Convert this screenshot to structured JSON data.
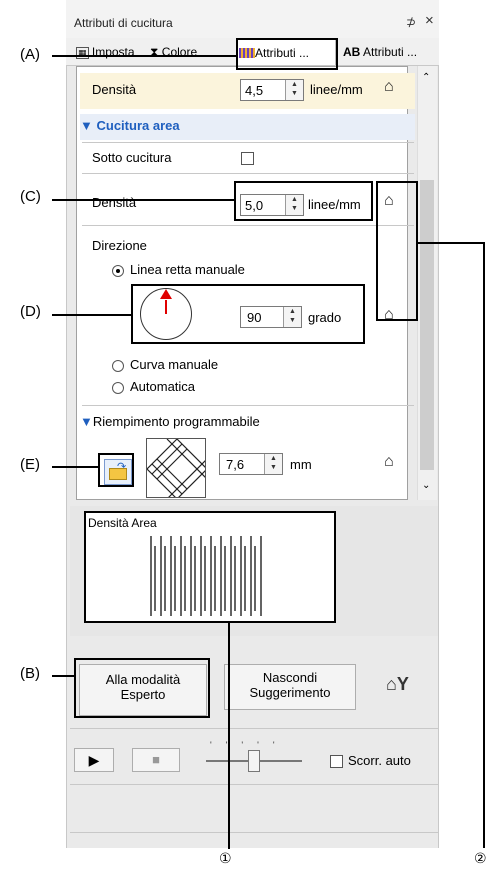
{
  "panel": {
    "title": "Attributi di cucitura",
    "pin_icon": "⊅",
    "close_icon": "×"
  },
  "tabs": [
    {
      "label": "Imposta",
      "icon": "settings-icon"
    },
    {
      "label": "Colore",
      "icon": "hourglass-icon"
    },
    {
      "label": "Attributi ...",
      "icon": "stitch-pattern-icon"
    },
    {
      "label": "Attributi ...",
      "icon": "text-ab-icon",
      "prefix": "AB"
    }
  ],
  "rows": {
    "density_top": {
      "label": "Densità",
      "value": "4,5",
      "unit": "linee/mm"
    },
    "section_area": {
      "label": "Cucitura area"
    },
    "under_sewing": {
      "label": "Sotto cucitura",
      "checked": false
    },
    "density_area": {
      "label": "Densità",
      "value": "5,0",
      "unit": "linee/mm"
    },
    "direction": {
      "label": "Direzione"
    },
    "radio_manual_line": {
      "label": "Linea retta manuale",
      "selected": true
    },
    "angle": {
      "value": "90",
      "unit": "grado"
    },
    "radio_manual_curve": {
      "label": "Curva manuale",
      "selected": false
    },
    "radio_auto": {
      "label": "Automatica",
      "selected": false
    },
    "section_prog_fill": {
      "label": "Riempimento programmabile"
    },
    "prog_fill_size": {
      "value": "7,6",
      "unit": "mm"
    }
  },
  "preview": {
    "title": "Densità Area"
  },
  "buttons": {
    "expert_mode": [
      "Alla modalità",
      "Esperto"
    ],
    "hide_hint": [
      "Nascondi",
      "Suggerimento"
    ]
  },
  "playback": {
    "auto_scroll_label": "Scorr. auto",
    "auto_scroll_checked": false,
    "slider_level": 0.5
  },
  "callouts": {
    "a": "(A)",
    "b": "(B)",
    "c": "(C)",
    "d": "(D)",
    "e": "(E)",
    "one": "①",
    "two": "②"
  },
  "colors": {
    "highlight_row": "#fbf4dc",
    "section_text": "#1f5fbf",
    "arrow": "#e00000"
  }
}
